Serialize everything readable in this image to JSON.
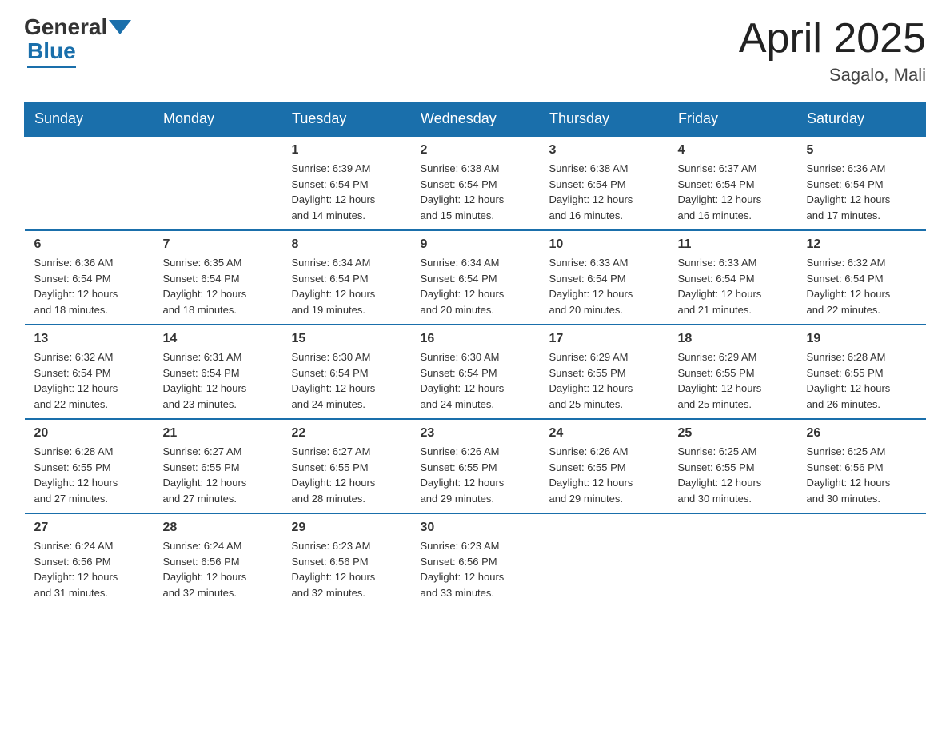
{
  "logo": {
    "general_text": "General",
    "blue_text": "Blue"
  },
  "header": {
    "title": "April 2025",
    "location": "Sagalo, Mali"
  },
  "weekdays": [
    "Sunday",
    "Monday",
    "Tuesday",
    "Wednesday",
    "Thursday",
    "Friday",
    "Saturday"
  ],
  "weeks": [
    [
      {
        "day": "",
        "info": ""
      },
      {
        "day": "",
        "info": ""
      },
      {
        "day": "1",
        "info": "Sunrise: 6:39 AM\nSunset: 6:54 PM\nDaylight: 12 hours\nand 14 minutes."
      },
      {
        "day": "2",
        "info": "Sunrise: 6:38 AM\nSunset: 6:54 PM\nDaylight: 12 hours\nand 15 minutes."
      },
      {
        "day": "3",
        "info": "Sunrise: 6:38 AM\nSunset: 6:54 PM\nDaylight: 12 hours\nand 16 minutes."
      },
      {
        "day": "4",
        "info": "Sunrise: 6:37 AM\nSunset: 6:54 PM\nDaylight: 12 hours\nand 16 minutes."
      },
      {
        "day": "5",
        "info": "Sunrise: 6:36 AM\nSunset: 6:54 PM\nDaylight: 12 hours\nand 17 minutes."
      }
    ],
    [
      {
        "day": "6",
        "info": "Sunrise: 6:36 AM\nSunset: 6:54 PM\nDaylight: 12 hours\nand 18 minutes."
      },
      {
        "day": "7",
        "info": "Sunrise: 6:35 AM\nSunset: 6:54 PM\nDaylight: 12 hours\nand 18 minutes."
      },
      {
        "day": "8",
        "info": "Sunrise: 6:34 AM\nSunset: 6:54 PM\nDaylight: 12 hours\nand 19 minutes."
      },
      {
        "day": "9",
        "info": "Sunrise: 6:34 AM\nSunset: 6:54 PM\nDaylight: 12 hours\nand 20 minutes."
      },
      {
        "day": "10",
        "info": "Sunrise: 6:33 AM\nSunset: 6:54 PM\nDaylight: 12 hours\nand 20 minutes."
      },
      {
        "day": "11",
        "info": "Sunrise: 6:33 AM\nSunset: 6:54 PM\nDaylight: 12 hours\nand 21 minutes."
      },
      {
        "day": "12",
        "info": "Sunrise: 6:32 AM\nSunset: 6:54 PM\nDaylight: 12 hours\nand 22 minutes."
      }
    ],
    [
      {
        "day": "13",
        "info": "Sunrise: 6:32 AM\nSunset: 6:54 PM\nDaylight: 12 hours\nand 22 minutes."
      },
      {
        "day": "14",
        "info": "Sunrise: 6:31 AM\nSunset: 6:54 PM\nDaylight: 12 hours\nand 23 minutes."
      },
      {
        "day": "15",
        "info": "Sunrise: 6:30 AM\nSunset: 6:54 PM\nDaylight: 12 hours\nand 24 minutes."
      },
      {
        "day": "16",
        "info": "Sunrise: 6:30 AM\nSunset: 6:54 PM\nDaylight: 12 hours\nand 24 minutes."
      },
      {
        "day": "17",
        "info": "Sunrise: 6:29 AM\nSunset: 6:55 PM\nDaylight: 12 hours\nand 25 minutes."
      },
      {
        "day": "18",
        "info": "Sunrise: 6:29 AM\nSunset: 6:55 PM\nDaylight: 12 hours\nand 25 minutes."
      },
      {
        "day": "19",
        "info": "Sunrise: 6:28 AM\nSunset: 6:55 PM\nDaylight: 12 hours\nand 26 minutes."
      }
    ],
    [
      {
        "day": "20",
        "info": "Sunrise: 6:28 AM\nSunset: 6:55 PM\nDaylight: 12 hours\nand 27 minutes."
      },
      {
        "day": "21",
        "info": "Sunrise: 6:27 AM\nSunset: 6:55 PM\nDaylight: 12 hours\nand 27 minutes."
      },
      {
        "day": "22",
        "info": "Sunrise: 6:27 AM\nSunset: 6:55 PM\nDaylight: 12 hours\nand 28 minutes."
      },
      {
        "day": "23",
        "info": "Sunrise: 6:26 AM\nSunset: 6:55 PM\nDaylight: 12 hours\nand 29 minutes."
      },
      {
        "day": "24",
        "info": "Sunrise: 6:26 AM\nSunset: 6:55 PM\nDaylight: 12 hours\nand 29 minutes."
      },
      {
        "day": "25",
        "info": "Sunrise: 6:25 AM\nSunset: 6:55 PM\nDaylight: 12 hours\nand 30 minutes."
      },
      {
        "day": "26",
        "info": "Sunrise: 6:25 AM\nSunset: 6:56 PM\nDaylight: 12 hours\nand 30 minutes."
      }
    ],
    [
      {
        "day": "27",
        "info": "Sunrise: 6:24 AM\nSunset: 6:56 PM\nDaylight: 12 hours\nand 31 minutes."
      },
      {
        "day": "28",
        "info": "Sunrise: 6:24 AM\nSunset: 6:56 PM\nDaylight: 12 hours\nand 32 minutes."
      },
      {
        "day": "29",
        "info": "Sunrise: 6:23 AM\nSunset: 6:56 PM\nDaylight: 12 hours\nand 32 minutes."
      },
      {
        "day": "30",
        "info": "Sunrise: 6:23 AM\nSunset: 6:56 PM\nDaylight: 12 hours\nand 33 minutes."
      },
      {
        "day": "",
        "info": ""
      },
      {
        "day": "",
        "info": ""
      },
      {
        "day": "",
        "info": ""
      }
    ]
  ]
}
